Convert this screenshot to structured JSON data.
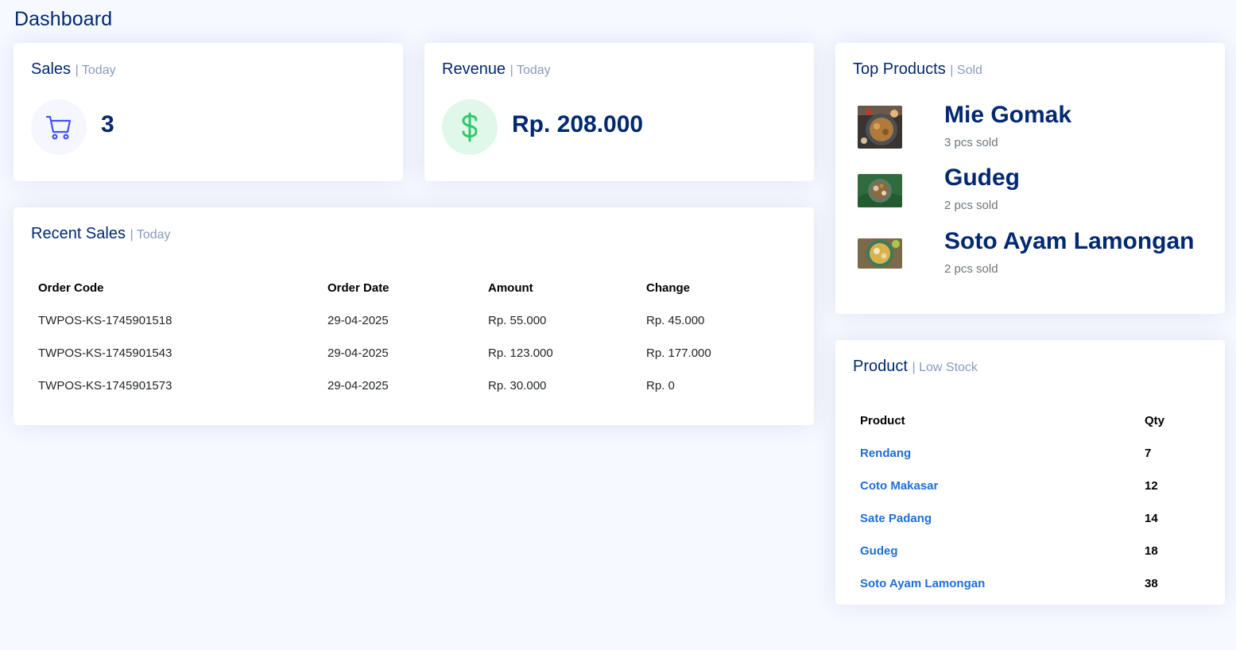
{
  "page_title": "Dashboard",
  "sales_card": {
    "title": "Sales",
    "subtitle": "| Today",
    "icon": "cart-icon",
    "value": "3"
  },
  "revenue_card": {
    "title": "Revenue",
    "subtitle": "| Today",
    "icon": "dollar-icon",
    "value": "Rp. 208.000"
  },
  "top_products": {
    "title": "Top Products",
    "subtitle": "| Sold",
    "items": [
      {
        "name": "Mie Gomak",
        "sold": "3 pcs sold"
      },
      {
        "name": "Gudeg",
        "sold": "2 pcs sold"
      },
      {
        "name": "Soto Ayam Lamongan",
        "sold": "2 pcs sold"
      }
    ]
  },
  "recent_sales": {
    "title": "Recent Sales",
    "subtitle": "| Today",
    "columns": [
      "Order Code",
      "Order Date",
      "Amount",
      "Change"
    ],
    "rows": [
      [
        "TWPOS-KS-1745901518",
        "29-04-2025",
        "Rp. 55.000",
        "Rp. 45.000"
      ],
      [
        "TWPOS-KS-1745901543",
        "29-04-2025",
        "Rp. 123.000",
        "Rp. 177.000"
      ],
      [
        "TWPOS-KS-1745901573",
        "29-04-2025",
        "Rp. 30.000",
        "Rp. 0"
      ]
    ]
  },
  "low_stock": {
    "title": "Product",
    "subtitle": "| Low Stock",
    "columns": [
      "Product",
      "Qty"
    ],
    "rows": [
      [
        "Rendang",
        "7"
      ],
      [
        "Coto Makasar",
        "12"
      ],
      [
        "Sate Padang",
        "14"
      ],
      [
        "Gudeg",
        "18"
      ],
      [
        "Soto Ayam Lamongan",
        "38"
      ]
    ]
  },
  "colors": {
    "primary": "#012970",
    "muted": "#899bbd",
    "link": "#1f6fd6",
    "sales_icon_bg": "#f6f6fe",
    "sales_icon": "#4154f1",
    "revenue_icon_bg": "#e0f8e9",
    "revenue_icon": "#2eca6a"
  }
}
